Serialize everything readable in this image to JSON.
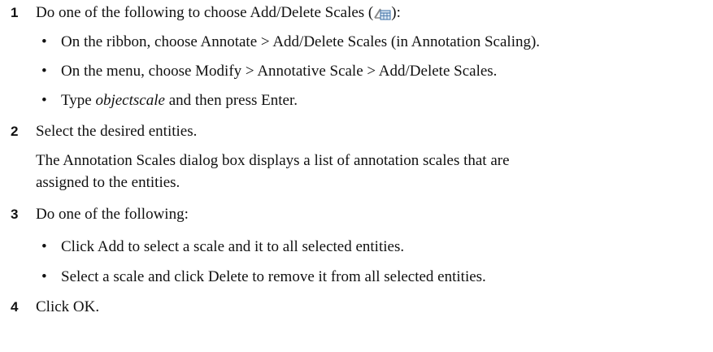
{
  "steps": [
    {
      "number": "1",
      "text_before_icon": "Do one of the following to choose Add/Delete Scales (",
      "icon": "add-delete-scales-icon",
      "text_after_icon": "):",
      "bullets": [
        "On the ribbon, choose Annotate > Add/Delete Scales (in Annotation Scaling).",
        "On the menu, choose Modify > Annotative Scale > Add/Delete Scales."
      ],
      "typed_bullet": {
        "prefix": "Type ",
        "command": "objectscale",
        "suffix": " and then press Enter."
      }
    },
    {
      "number": "2",
      "text": "Select the desired entities.",
      "paragraph_line1": "The Annotation Scales dialog box displays a list of annotation scales that are",
      "paragraph_line2": "assigned to the entities."
    },
    {
      "number": "3",
      "text": "Do one of the following:",
      "bullets": [
        "Click Add to select a scale and it to all selected entities.",
        "Select a scale and click Delete to remove it from all selected entities."
      ]
    },
    {
      "number": "4",
      "text": "Click OK."
    }
  ],
  "bullet_glyph": "•"
}
